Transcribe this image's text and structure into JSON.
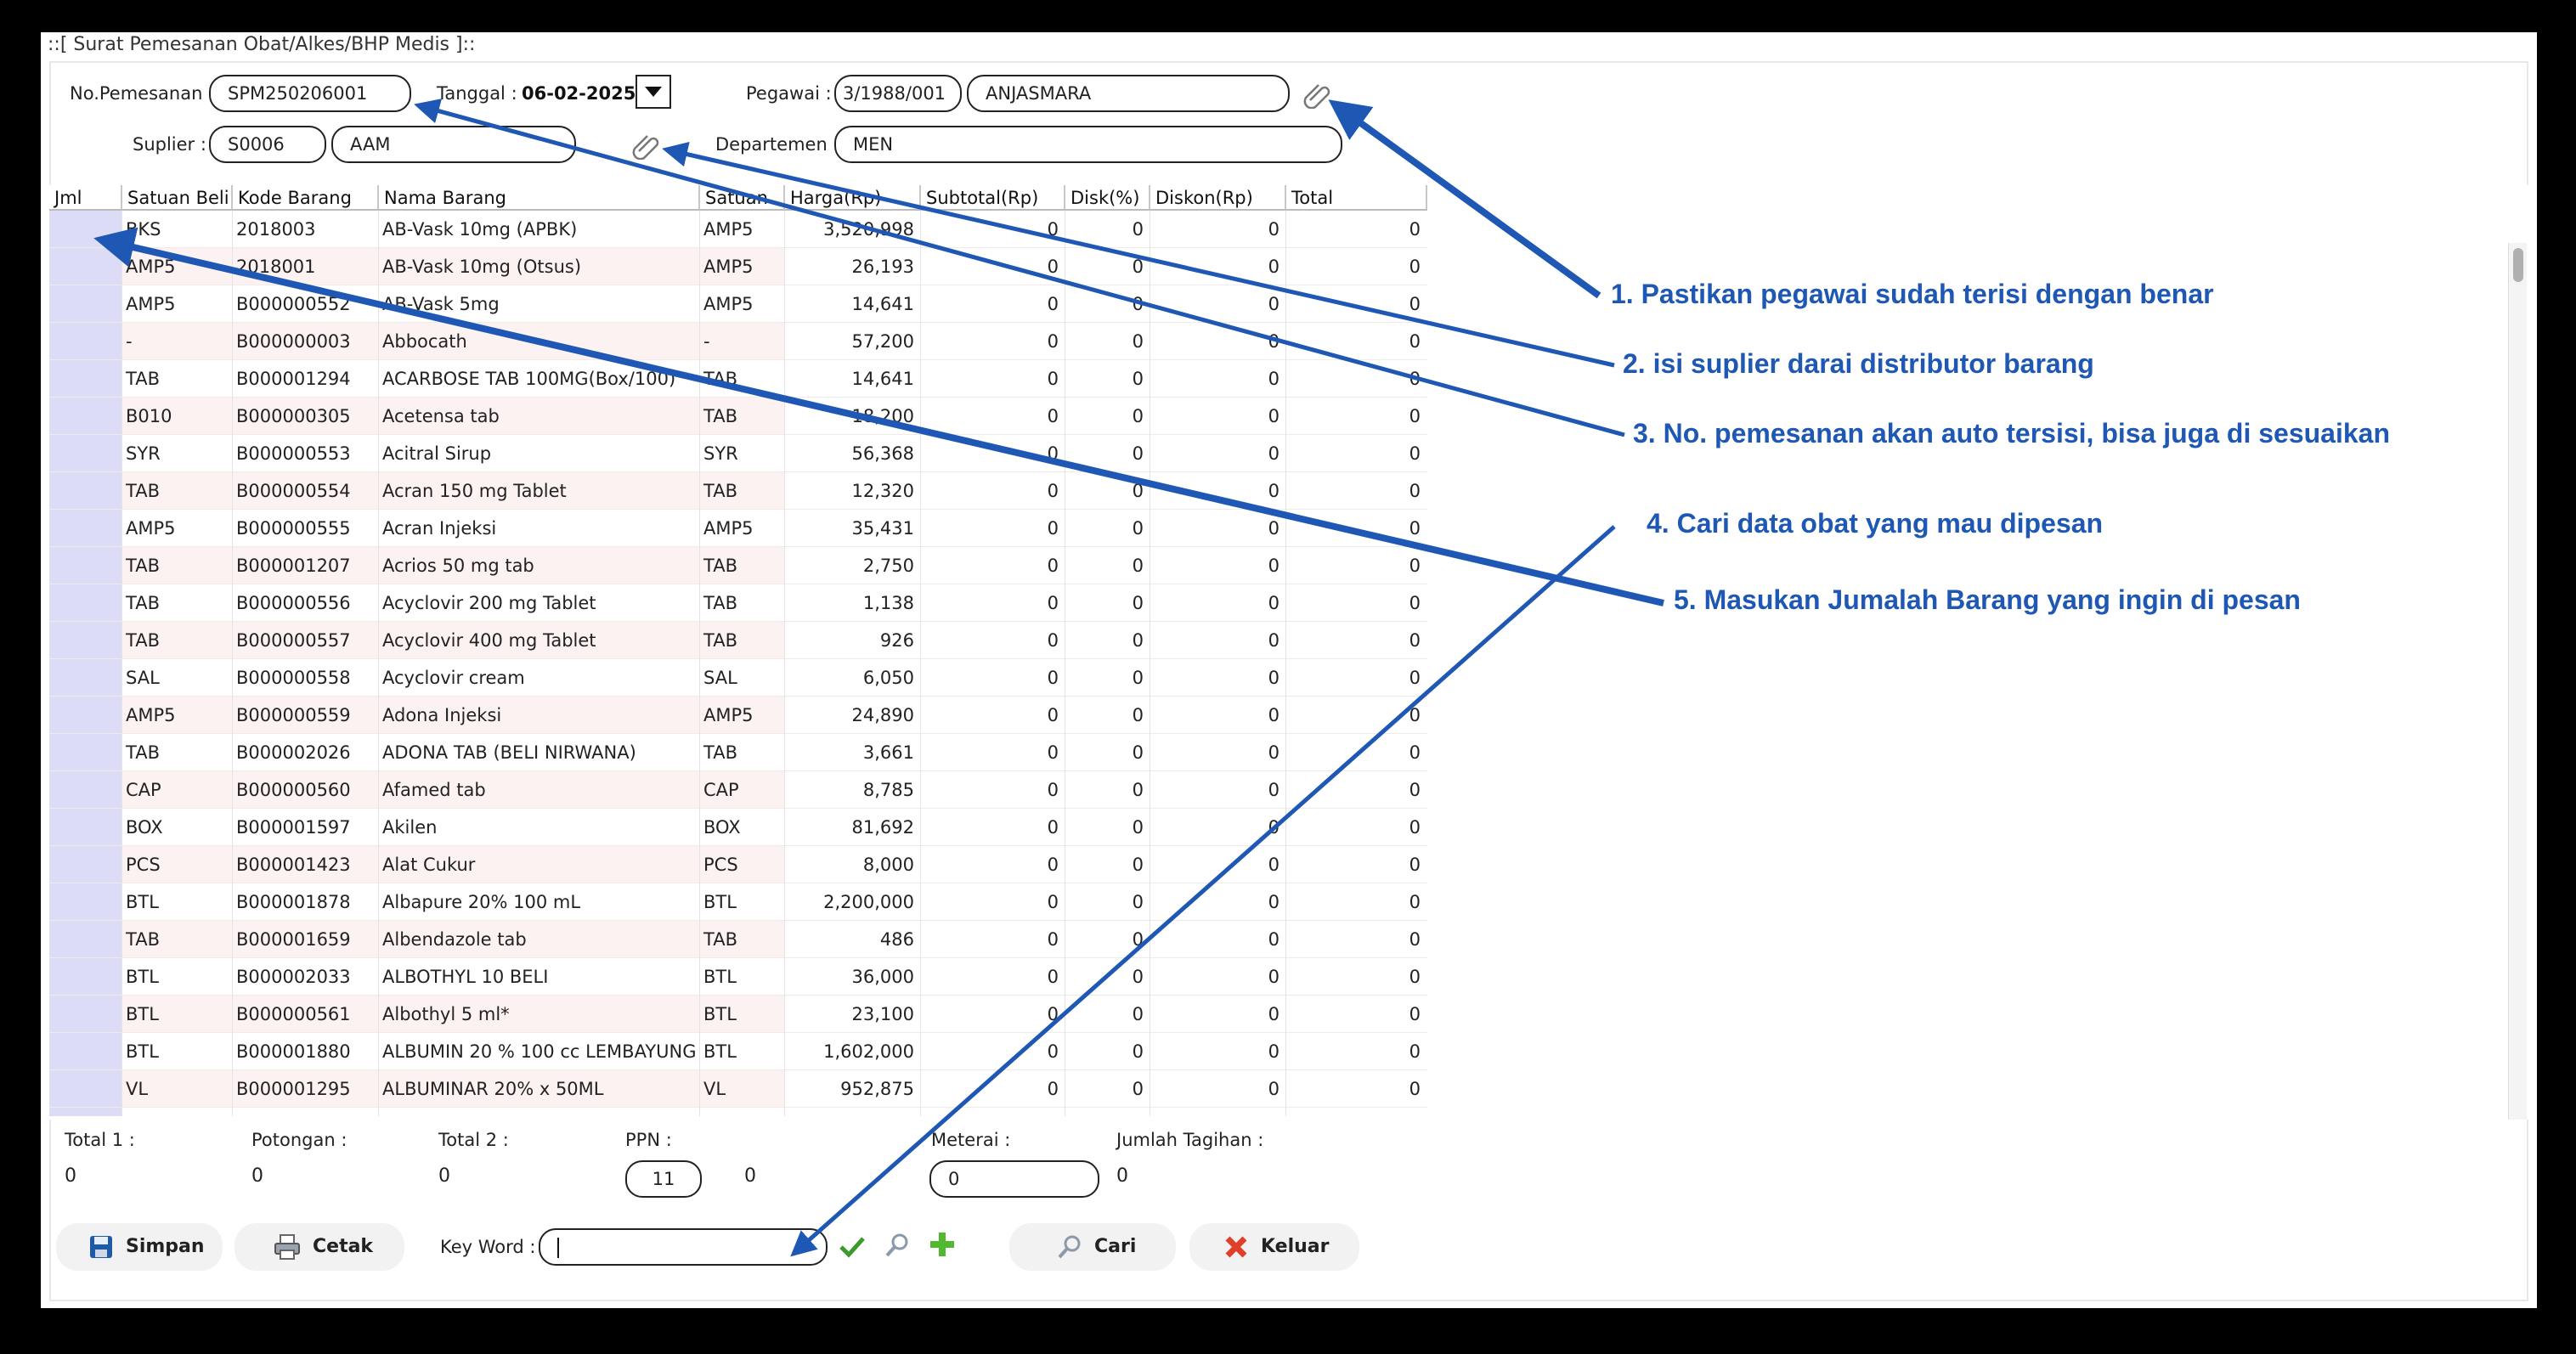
{
  "window": {
    "title": "::[ Surat Pemesanan Obat/Alkes/BHP Medis ]::"
  },
  "form": {
    "no_pemesanan_label": "No.Pemesanan :",
    "no_pemesanan_value": "SPM250206001",
    "tanggal_label": "Tanggal :",
    "tanggal_value": "06-02-2025",
    "pegawai_label": "Pegawai :",
    "pegawai_code": "3/1988/001",
    "pegawai_name": "ANJASMARA",
    "suplier_label": "Suplier :",
    "suplier_code": "S0006",
    "suplier_name": "AAM",
    "departemen_label": "Departemen :",
    "departemen_value": "MEN"
  },
  "table": {
    "columns": [
      "Jml",
      "Satuan Beli",
      "Kode Barang",
      "Nama Barang",
      "Satuan",
      "Harga(Rp)",
      "Subtotal(Rp)",
      "Disk(%)",
      "Diskon(Rp)",
      "Total"
    ],
    "rows": [
      {
        "satuan_beli": "BKS",
        "kode": "2018003",
        "nama": "AB-Vask 10mg (APBK)",
        "satuan": "AMP5",
        "harga": "3,520,998",
        "subtotal": "0",
        "disk": "0",
        "diskon": "0",
        "total": "0"
      },
      {
        "satuan_beli": "AMP5",
        "kode": "2018001",
        "nama": "AB-Vask 10mg (Otsus)",
        "satuan": "AMP5",
        "harga": "26,193",
        "subtotal": "0",
        "disk": "0",
        "diskon": "0",
        "total": "0"
      },
      {
        "satuan_beli": "AMP5",
        "kode": "B000000552",
        "nama": "AB-Vask 5mg",
        "satuan": "AMP5",
        "harga": "14,641",
        "subtotal": "0",
        "disk": "0",
        "diskon": "0",
        "total": "0"
      },
      {
        "satuan_beli": "-",
        "kode": "B000000003",
        "nama": "Abbocath",
        "satuan": "-",
        "harga": "57,200",
        "subtotal": "0",
        "disk": "0",
        "diskon": "0",
        "total": "0"
      },
      {
        "satuan_beli": "TAB",
        "kode": "B000001294",
        "nama": "ACARBOSE TAB 100MG(Box/100)",
        "satuan": "TAB",
        "harga": "14,641",
        "subtotal": "0",
        "disk": "0",
        "diskon": "0",
        "total": "0"
      },
      {
        "satuan_beli": "B010",
        "kode": "B000000305",
        "nama": "Acetensa tab",
        "satuan": "TAB",
        "harga": "18,200",
        "subtotal": "0",
        "disk": "0",
        "diskon": "0",
        "total": "0"
      },
      {
        "satuan_beli": "SYR",
        "kode": "B000000553",
        "nama": "Acitral Sirup",
        "satuan": "SYR",
        "harga": "56,368",
        "subtotal": "0",
        "disk": "0",
        "diskon": "0",
        "total": "0"
      },
      {
        "satuan_beli": "TAB",
        "kode": "B000000554",
        "nama": "Acran 150 mg Tablet",
        "satuan": "TAB",
        "harga": "12,320",
        "subtotal": "0",
        "disk": "0",
        "diskon": "0",
        "total": "0"
      },
      {
        "satuan_beli": "AMP5",
        "kode": "B000000555",
        "nama": "Acran Injeksi",
        "satuan": "AMP5",
        "harga": "35,431",
        "subtotal": "0",
        "disk": "0",
        "diskon": "0",
        "total": "0"
      },
      {
        "satuan_beli": "TAB",
        "kode": "B000001207",
        "nama": "Acrios 50 mg tab",
        "satuan": "TAB",
        "harga": "2,750",
        "subtotal": "0",
        "disk": "0",
        "diskon": "0",
        "total": "0"
      },
      {
        "satuan_beli": "TAB",
        "kode": "B000000556",
        "nama": "Acyclovir 200 mg Tablet",
        "satuan": "TAB",
        "harga": "1,138",
        "subtotal": "0",
        "disk": "0",
        "diskon": "0",
        "total": "0"
      },
      {
        "satuan_beli": "TAB",
        "kode": "B000000557",
        "nama": "Acyclovir 400 mg Tablet",
        "satuan": "TAB",
        "harga": "926",
        "subtotal": "0",
        "disk": "0",
        "diskon": "0",
        "total": "0"
      },
      {
        "satuan_beli": "SAL",
        "kode": "B000000558",
        "nama": "Acyclovir cream",
        "satuan": "SAL",
        "harga": "6,050",
        "subtotal": "0",
        "disk": "0",
        "diskon": "0",
        "total": "0"
      },
      {
        "satuan_beli": "AMP5",
        "kode": "B000000559",
        "nama": "Adona Injeksi",
        "satuan": "AMP5",
        "harga": "24,890",
        "subtotal": "0",
        "disk": "0",
        "diskon": "0",
        "total": "0"
      },
      {
        "satuan_beli": "TAB",
        "kode": "B000002026",
        "nama": "ADONA TAB (BELI NIRWANA)",
        "satuan": "TAB",
        "harga": "3,661",
        "subtotal": "0",
        "disk": "0",
        "diskon": "0",
        "total": "0"
      },
      {
        "satuan_beli": "CAP",
        "kode": "B000000560",
        "nama": "Afamed tab",
        "satuan": "CAP",
        "harga": "8,785",
        "subtotal": "0",
        "disk": "0",
        "diskon": "0",
        "total": "0"
      },
      {
        "satuan_beli": "BOX",
        "kode": "B000001597",
        "nama": "Akilen",
        "satuan": "BOX",
        "harga": "81,692",
        "subtotal": "0",
        "disk": "0",
        "diskon": "0",
        "total": "0"
      },
      {
        "satuan_beli": "PCS",
        "kode": "B000001423",
        "nama": "Alat Cukur",
        "satuan": "PCS",
        "harga": "8,000",
        "subtotal": "0",
        "disk": "0",
        "diskon": "0",
        "total": "0"
      },
      {
        "satuan_beli": "BTL",
        "kode": "B000001878",
        "nama": "Albapure 20% 100 mL",
        "satuan": "BTL",
        "harga": "2,200,000",
        "subtotal": "0",
        "disk": "0",
        "diskon": "0",
        "total": "0"
      },
      {
        "satuan_beli": "TAB",
        "kode": "B000001659",
        "nama": "Albendazole tab",
        "satuan": "TAB",
        "harga": "486",
        "subtotal": "0",
        "disk": "0",
        "diskon": "0",
        "total": "0"
      },
      {
        "satuan_beli": "BTL",
        "kode": "B000002033",
        "nama": "ALBOTHYL 10 BELI",
        "satuan": "BTL",
        "harga": "36,000",
        "subtotal": "0",
        "disk": "0",
        "diskon": "0",
        "total": "0"
      },
      {
        "satuan_beli": "BTL",
        "kode": "B000000561",
        "nama": "Albothyl 5 ml*",
        "satuan": "BTL",
        "harga": "23,100",
        "subtotal": "0",
        "disk": "0",
        "diskon": "0",
        "total": "0"
      },
      {
        "satuan_beli": "BTL",
        "kode": "B000001880",
        "nama": "ALBUMIN 20 % 100 cc LEMBAYUNG",
        "satuan": "BTL",
        "harga": "1,602,000",
        "subtotal": "0",
        "disk": "0",
        "diskon": "0",
        "total": "0"
      },
      {
        "satuan_beli": "VL",
        "kode": "B000001295",
        "nama": "ALBUMINAR 20% x 50ML",
        "satuan": "VL",
        "harga": "952,875",
        "subtotal": "0",
        "disk": "0",
        "diskon": "0",
        "total": "0"
      }
    ]
  },
  "summary": {
    "total1_label": "Total 1 :",
    "total1_value": "0",
    "potongan_label": "Potongan :",
    "potongan_value": "0",
    "total2_label": "Total 2 :",
    "total2_value": "0",
    "ppn_label": "PPN :",
    "ppn_input": "11",
    "ppn_value": "0",
    "meterai_label": "Meterai :",
    "meterai_input": "0",
    "tagihan_label": "Jumlah Tagihan :",
    "tagihan_value": "0"
  },
  "toolbar": {
    "simpan_label": "Simpan",
    "cetak_label": "Cetak",
    "keyword_label": "Key Word :",
    "keyword_value": "",
    "cari_label": "Cari",
    "keluar_label": "Keluar"
  },
  "annotations": [
    "1. Pastikan pegawai sudah terisi dengan benar",
    "2. isi suplier darai distributor barang",
    "3. No. pemesanan akan auto tersisi, bisa juga di sesuaikan",
    "4. Cari data obat yang mau dipesan",
    "5. Masukan Jumalah Barang yang ingin di pesan"
  ],
  "colors": {
    "annotation": "#1e58b4",
    "jml_column": "#dcdcf7",
    "row_alt": "#fcf2f2"
  }
}
